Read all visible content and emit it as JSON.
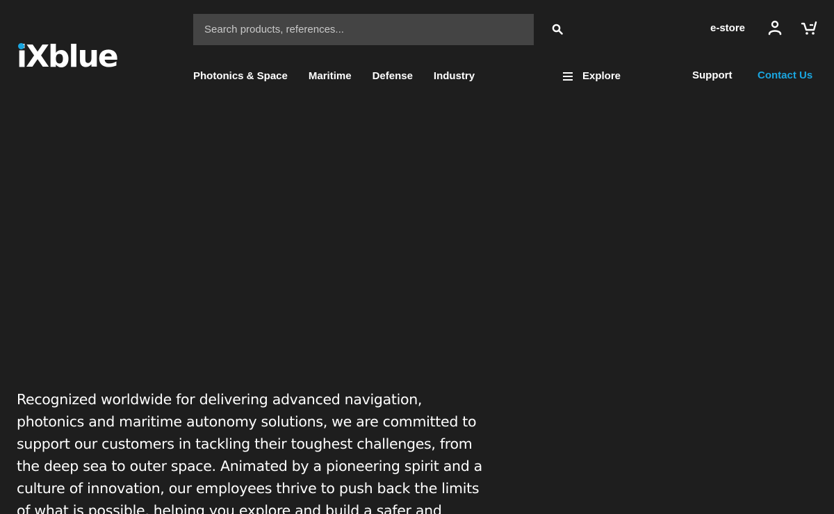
{
  "brand": {
    "logo_text": "iXblue",
    "accent_color": "#1aa6e0",
    "background_color": "#1e1e1e"
  },
  "search": {
    "placeholder": "Search products, references...",
    "value": "",
    "icon": "search-icon"
  },
  "utility": {
    "estore_label": "e-store",
    "account_icon": "user-icon",
    "cart_icon": "cart-icon"
  },
  "nav": {
    "items": [
      {
        "label": "Photonics & Space"
      },
      {
        "label": "Maritime"
      },
      {
        "label": "Defense"
      },
      {
        "label": "Industry"
      }
    ],
    "explore_label": "Explore",
    "explore_icon": "menu-icon",
    "support_label": "Support",
    "contact_label": "Contact Us"
  },
  "intro": {
    "text": "Recognized worldwide for delivering advanced navigation, photonics and maritime autonomy solutions, we are committed to support our customers in tackling their toughest challenges, from the deep sea to outer space. Animated by a pioneering spirit and a culture of innovation, our employees thrive to push back the limits of what is possible, helping you explore and build a safer and"
  }
}
